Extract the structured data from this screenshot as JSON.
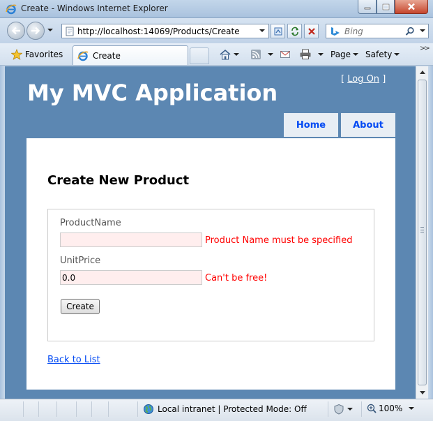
{
  "window": {
    "title": "Create - Windows Internet Explorer"
  },
  "navigation": {
    "url": "http://localhost:14069/Products/Create",
    "search_placeholder": "Bing"
  },
  "favorites_bar": {
    "favorites_label": "Favorites",
    "tab_title": "Create",
    "page_menu": "Page",
    "safety_menu": "Safety",
    "overflow": ">>"
  },
  "site": {
    "login_open": "[",
    "login_link": "Log On",
    "login_close": "]",
    "title": "My MVC Application",
    "menu": {
      "home": "Home",
      "about": "About"
    }
  },
  "form": {
    "heading": "Create New Product",
    "product_name": {
      "label": "ProductName",
      "value": "",
      "error": "Product Name must be specified"
    },
    "unit_price": {
      "label": "UnitPrice",
      "value": "0.0",
      "error": "Can't be free!"
    },
    "submit_label": "Create",
    "back_link": "Back to List"
  },
  "status_bar": {
    "zone_text": "Local intranet | Protected Mode: Off",
    "zoom": "100%"
  },
  "icons": [
    "ie-logo-icon",
    "minimize-icon",
    "maximize-icon",
    "close-icon",
    "back-arrow-icon",
    "forward-arrow-icon",
    "page-icon",
    "compatibility-view-icon",
    "refresh-icon",
    "stop-icon",
    "bing-logo-icon",
    "search-icon",
    "favorites-star-icon",
    "new-tab-icon",
    "home-icon",
    "rss-feed-icon",
    "read-mail-icon",
    "print-icon",
    "globe-icon",
    "zoom-icon"
  ],
  "colors": {
    "page_background": "#5c87b2",
    "menu_tab_background": "#e8eef4",
    "link": "#034af3",
    "error_text": "#ff0000",
    "invalid_field_background": "#ffeeee"
  }
}
